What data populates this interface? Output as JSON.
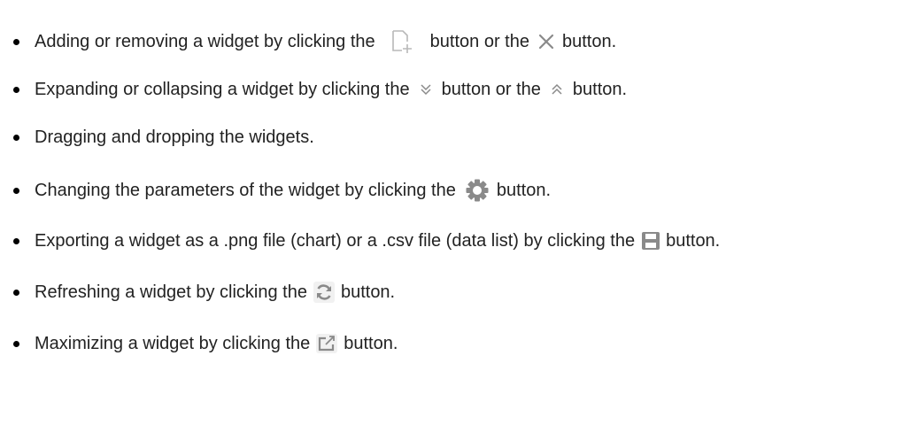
{
  "items": [
    {
      "before": "Adding or removing a widget by clicking the",
      "middle": "button or the",
      "after": "button.",
      "icons": [
        "add-widget-icon",
        "close-icon"
      ]
    },
    {
      "before": "Expanding or collapsing a widget by clicking the",
      "middle": "button or the",
      "after": "button.",
      "icons": [
        "expand-icon",
        "collapse-icon"
      ]
    },
    {
      "text": "Dragging and dropping the widgets."
    },
    {
      "before": "Changing the parameters of the widget by clicking the",
      "after": "button.",
      "icons": [
        "gear-icon"
      ]
    },
    {
      "before": "Exporting a widget as a .png file (chart) or a .csv file (data list) by clicking the",
      "after": "button.",
      "icons": [
        "save-icon"
      ]
    },
    {
      "before": "Refreshing a widget by clicking the",
      "after": "button.",
      "icons": [
        "refresh-icon"
      ]
    },
    {
      "before": "Maximizing a widget by clicking the",
      "after": "button.",
      "icons": [
        "maximize-icon"
      ]
    }
  ],
  "colors": {
    "text": "#222222",
    "bullet": "#000000",
    "icon_gray": "#8a8a8a",
    "icon_light": "#b8b8b8"
  }
}
